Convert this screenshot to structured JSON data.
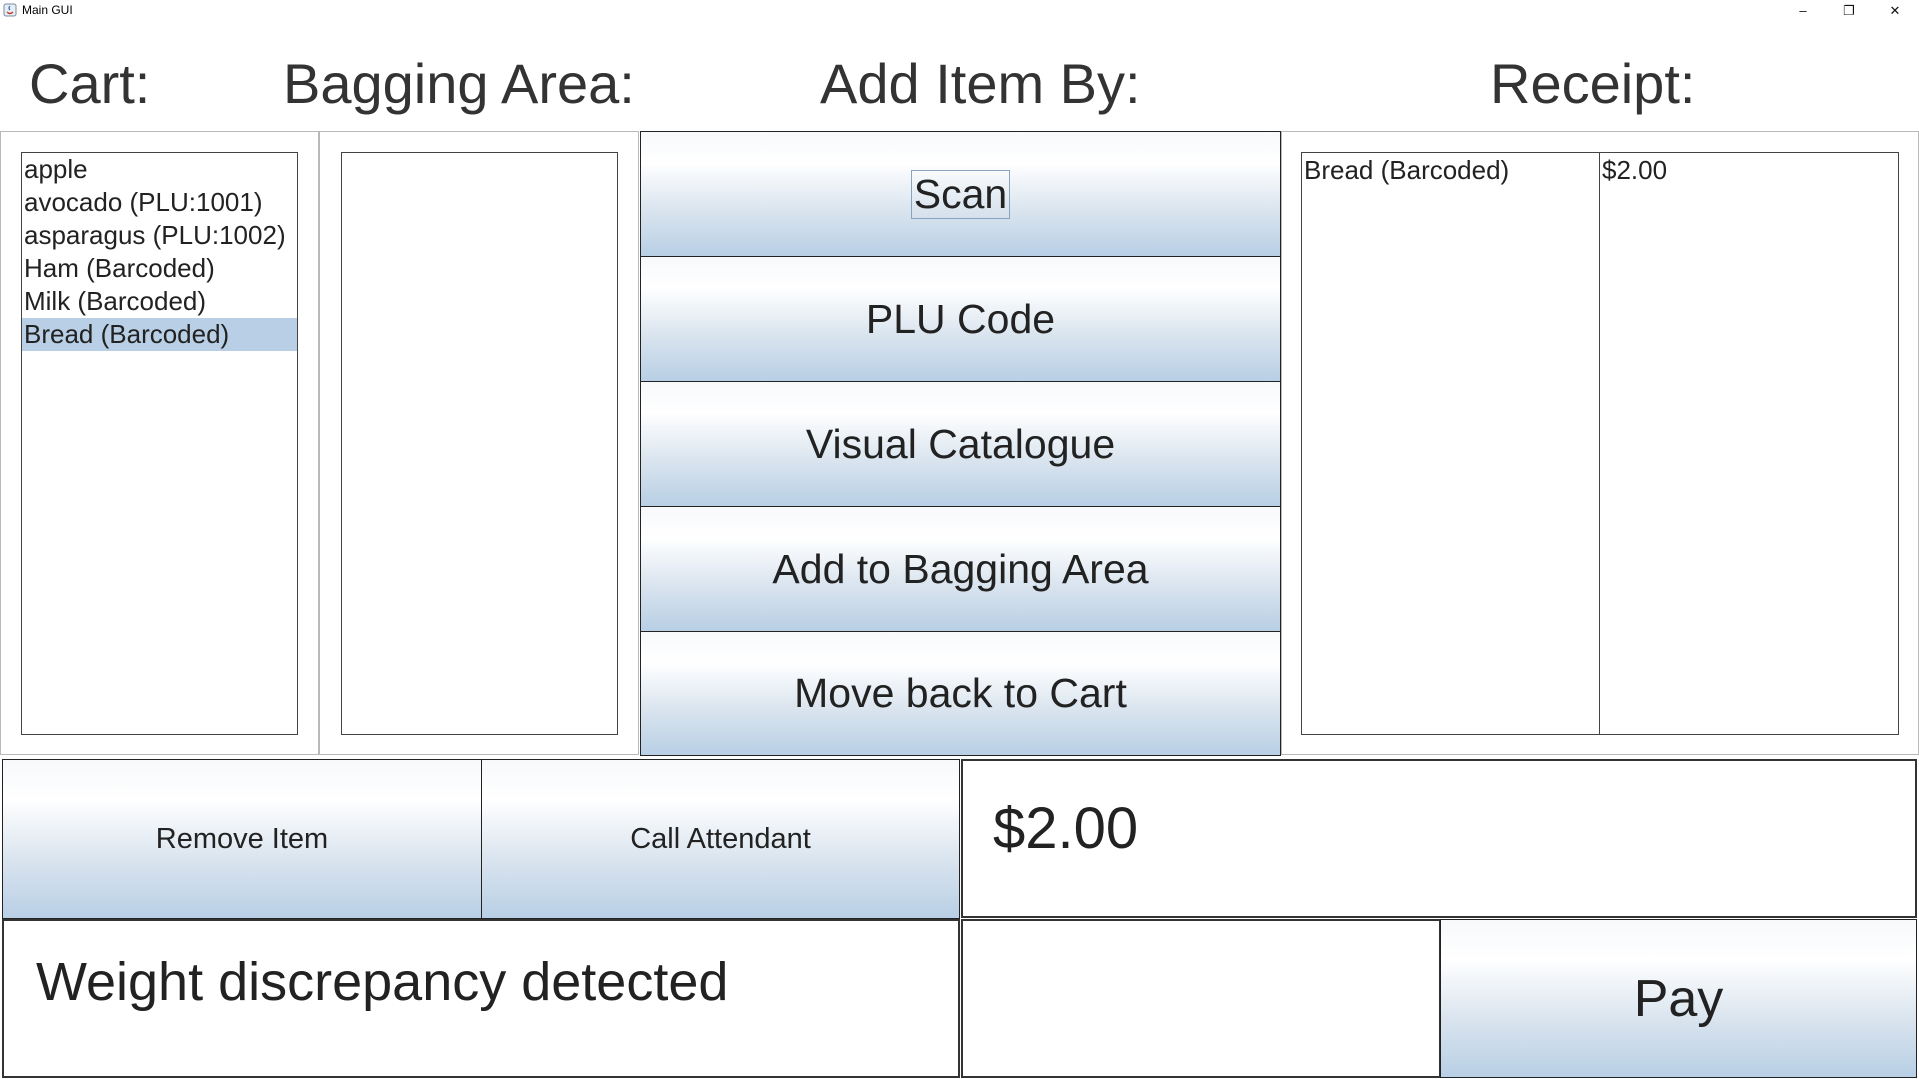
{
  "window": {
    "title": "Main GUI",
    "controls": {
      "minimize": "–",
      "maximize": "❐",
      "close": "✕"
    }
  },
  "headers": {
    "cart": "Cart:",
    "bagging_area": "Bagging Area:",
    "add_item_by": "Add Item By:",
    "receipt": "Receipt:"
  },
  "cart": {
    "items": [
      "apple",
      "avocado (PLU:1001)",
      "asparagus (PLU:1002)",
      "Ham (Barcoded)",
      "Milk (Barcoded)",
      "Bread (Barcoded)"
    ],
    "selected_item": "Bread (Barcoded)"
  },
  "bagging_area": {
    "items": []
  },
  "add_item_buttons": {
    "scan": "Scan",
    "plu_code": "PLU Code",
    "visual_catalogue": "Visual Catalogue",
    "add_to_bagging_area": "Add to Bagging Area",
    "move_back_to_cart": "Move back to Cart"
  },
  "receipt": {
    "rows": [
      {
        "item": "Bread (Barcoded)",
        "price": "$2.00"
      }
    ]
  },
  "actions": {
    "remove_item": "Remove Item",
    "call_attendant": "Call Attendant",
    "pay": "Pay"
  },
  "total": "$2.00",
  "status_message": "Weight discrepancy detected",
  "colors": {
    "selection": "#b8cfe5",
    "button_gradient_bottom": "#b8cfe5"
  }
}
